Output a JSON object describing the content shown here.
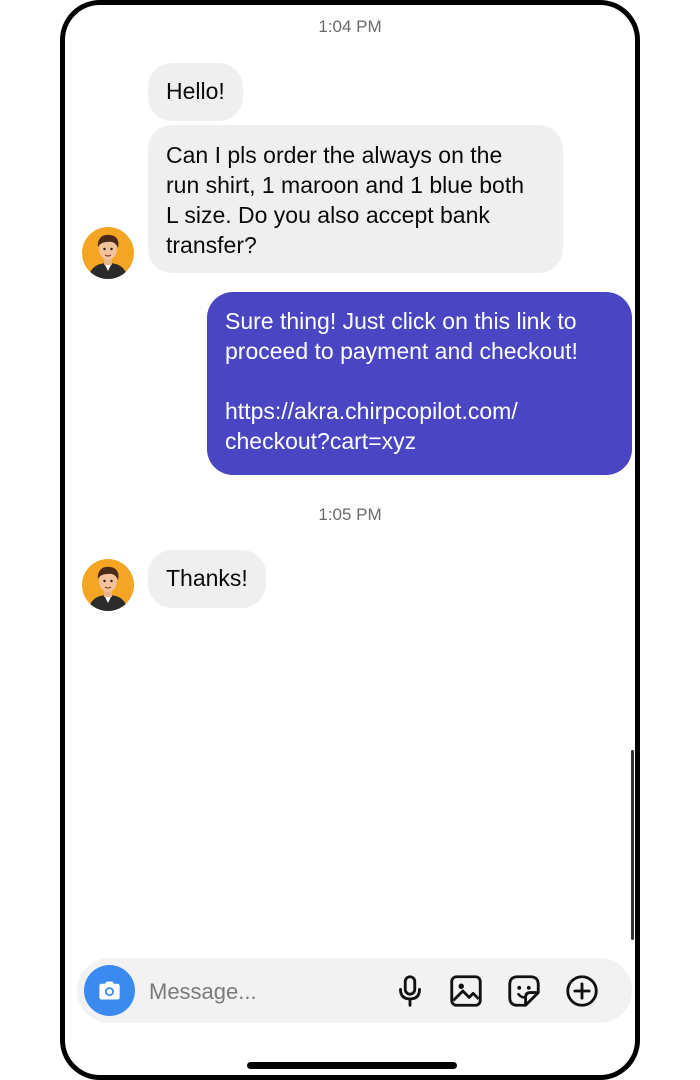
{
  "conversation": {
    "time_1": "1:04 PM",
    "msg_hello": "Hello!",
    "msg_order": "Can I pls order the always on the\nrun shirt, 1 maroon and 1 blue both\nL size. Do you also accept bank\ntransfer?",
    "msg_reply": "Sure thing! Just click on this link to\nproceed to payment and checkout!\n\nhttps://akra.chirpcopilot.com/\ncheckout?cart=xyz",
    "time_2": "1:05 PM",
    "msg_thanks": "Thanks!"
  },
  "composer": {
    "placeholder": "Message..."
  },
  "icons": {
    "camera": "camera-icon",
    "mic": "microphone-icon",
    "gallery": "image-icon",
    "sticker": "sticker-icon",
    "plus": "plus-circle-icon"
  },
  "colors": {
    "outgoing_bubble": "#4a45c2",
    "incoming_bubble": "#efefef",
    "camera_button": "#3b8af0",
    "avatar_bg": "#f5a524"
  }
}
